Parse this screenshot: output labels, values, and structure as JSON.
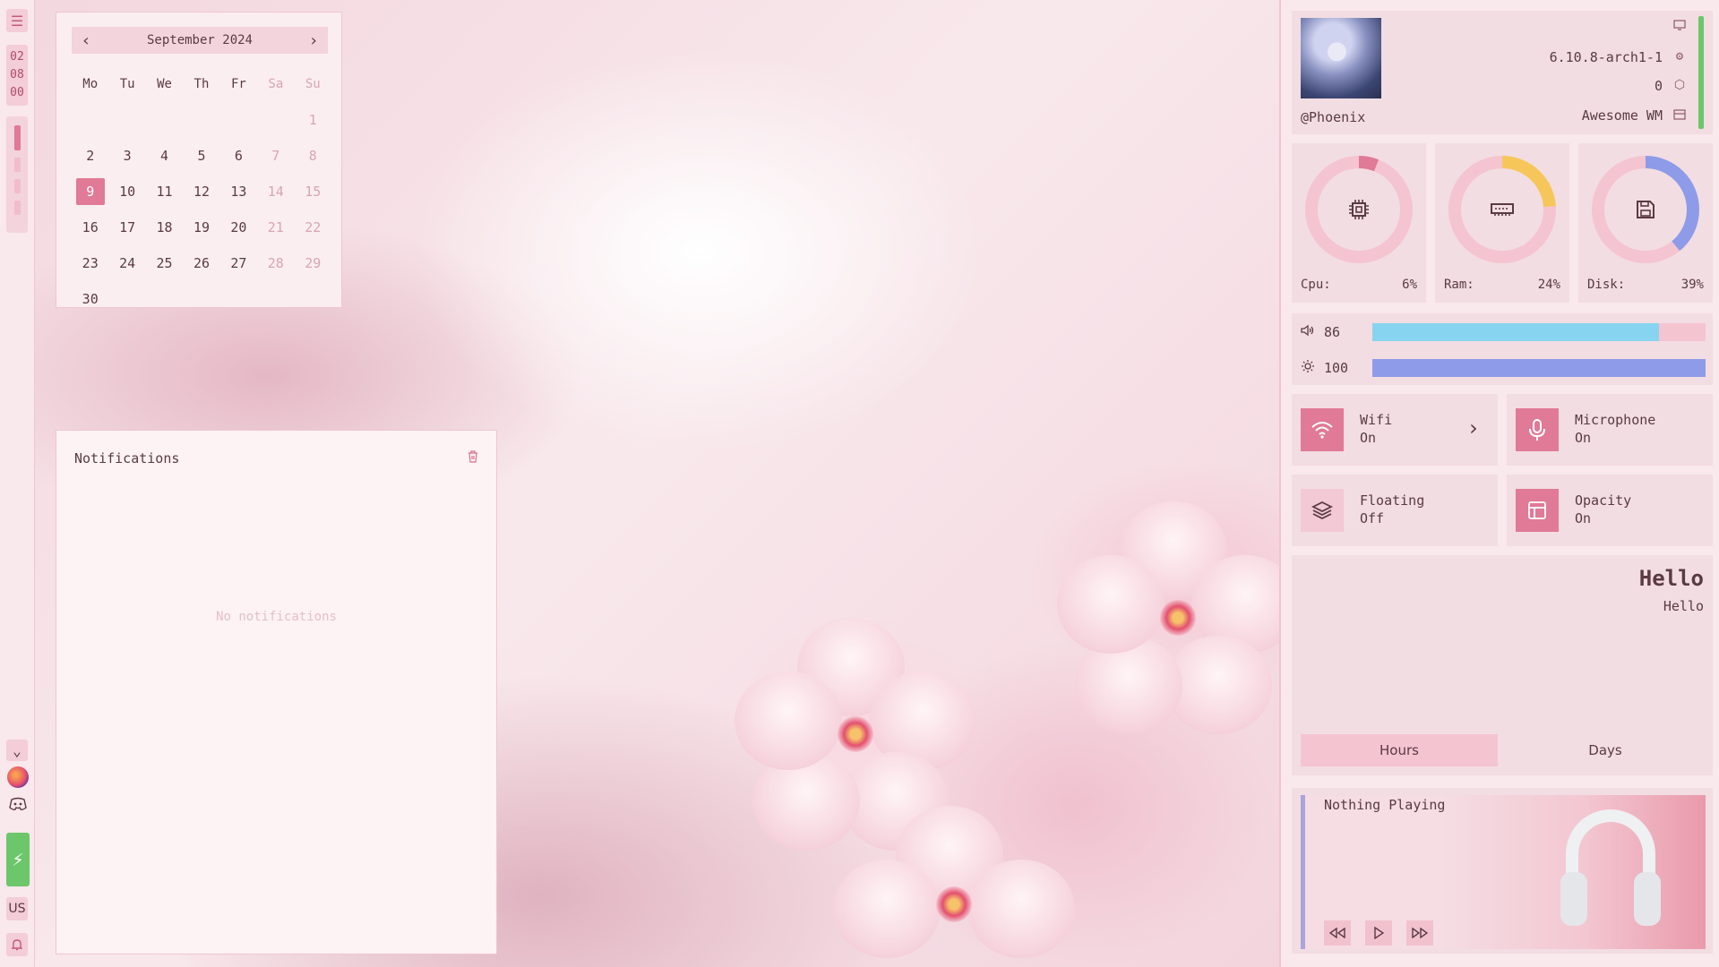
{
  "leftbar": {
    "menu_icon": "hamburger-icon",
    "clock": {
      "hour": "02",
      "minute": "08",
      "second": "00"
    },
    "tray": {
      "expand_icon": "chevron-down-icon",
      "apps": [
        "firefox-icon",
        "discord-icon"
      ]
    },
    "power_icon": "lightning-icon",
    "keyboard_layout": "US",
    "notifications_icon": "bell-icon"
  },
  "calendar": {
    "title": "September 2024",
    "prev_icon": "chevron-left-icon",
    "next_icon": "chevron-right-icon",
    "weekdays": [
      "Mo",
      "Tu",
      "We",
      "Th",
      "Fr",
      "Sa",
      "Su"
    ],
    "weeks": [
      [
        "",
        "",
        "",
        "",
        "",
        "",
        "1"
      ],
      [
        "2",
        "3",
        "4",
        "5",
        "6",
        "7",
        "8"
      ],
      [
        "9",
        "10",
        "11",
        "12",
        "13",
        "14",
        "15"
      ],
      [
        "16",
        "17",
        "18",
        "19",
        "20",
        "21",
        "22"
      ],
      [
        "23",
        "24",
        "25",
        "26",
        "27",
        "28",
        "29"
      ],
      [
        "30",
        "",
        "",
        "",
        "",
        "",
        ""
      ]
    ],
    "today": "9"
  },
  "notifications": {
    "title": "Notifications",
    "clear_icon": "trash-icon",
    "empty_text": "No notifications"
  },
  "profile": {
    "username": "@Phoenix",
    "kernel": "6.10.8-arch1-1",
    "packages": "0",
    "wm": "Awesome WM",
    "icons": [
      "monitor-icon",
      "gear-icon",
      "package-icon",
      "window-icon"
    ],
    "accent_color": "#6cc76a"
  },
  "stats": [
    {
      "label": "Cpu:",
      "value": "6%",
      "percent": 6,
      "color": "#e07a96",
      "icon": "cpu-icon"
    },
    {
      "label": "Ram:",
      "value": "24%",
      "percent": 24,
      "color": "#f7c65a",
      "icon": "memory-icon"
    },
    {
      "label": "Disk:",
      "value": "39%",
      "percent": 39,
      "color": "#8e9be8",
      "icon": "floppy-icon"
    }
  ],
  "sliders": {
    "volume": {
      "value": "86",
      "percent": 86,
      "icon": "speaker-icon",
      "color": "#86d4f0"
    },
    "brightness": {
      "value": "100",
      "percent": 100,
      "icon": "sun-icon",
      "color": "#8e9be8"
    }
  },
  "toggles": [
    {
      "name": "Wifi",
      "state": "On",
      "icon": "wifi-icon",
      "has_chevron": true
    },
    {
      "name": "Microphone",
      "state": "On",
      "icon": "microphone-icon"
    },
    {
      "name": "Floating",
      "state": "Off",
      "icon": "layers-icon"
    },
    {
      "name": "Opacity",
      "state": "On",
      "icon": "layout-icon"
    }
  ],
  "greeting": {
    "title": "Hello",
    "subtitle": "Hello",
    "tabs": [
      "Hours",
      "Days"
    ],
    "active_tab": "Hours"
  },
  "player": {
    "title": "Nothing Playing",
    "controls": [
      "rewind-icon",
      "play-icon",
      "fast-forward-icon"
    ],
    "cover_icon": "headphones-icon"
  }
}
